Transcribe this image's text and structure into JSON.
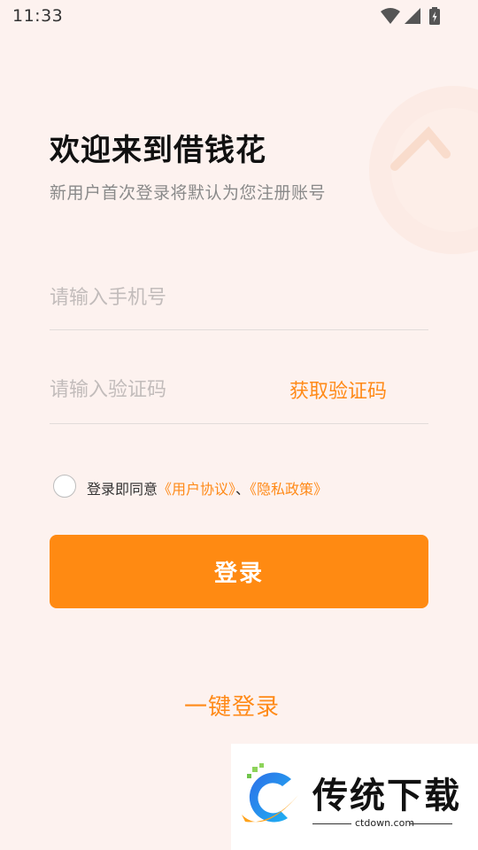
{
  "status_bar": {
    "time": "11:33",
    "icons": [
      "wifi-icon",
      "signal-icon",
      "battery-icon"
    ]
  },
  "login": {
    "title": "欢迎来到借钱花",
    "subtitle": "新用户首次登录将默认为您注册账号",
    "phone": {
      "placeholder": "请输入手机号",
      "value": ""
    },
    "code": {
      "placeholder": "请输入验证码",
      "value": "",
      "get_code_label": "获取验证码"
    },
    "agreement": {
      "checked": false,
      "prefix": "登录即同意",
      "user_agreement": "《用户协议》",
      "separator": "、",
      "privacy_policy": "《隐私政策》"
    },
    "login_button": "登录",
    "one_key_login": "一键登录"
  },
  "watermark": {
    "title": "传统下载",
    "site": "ctdown.com"
  },
  "colors": {
    "accent": "#ff8a12",
    "background": "#fdf2ef",
    "title": "#111111",
    "subtitle": "#8a8a8a",
    "placeholder": "#c2bcbb"
  }
}
